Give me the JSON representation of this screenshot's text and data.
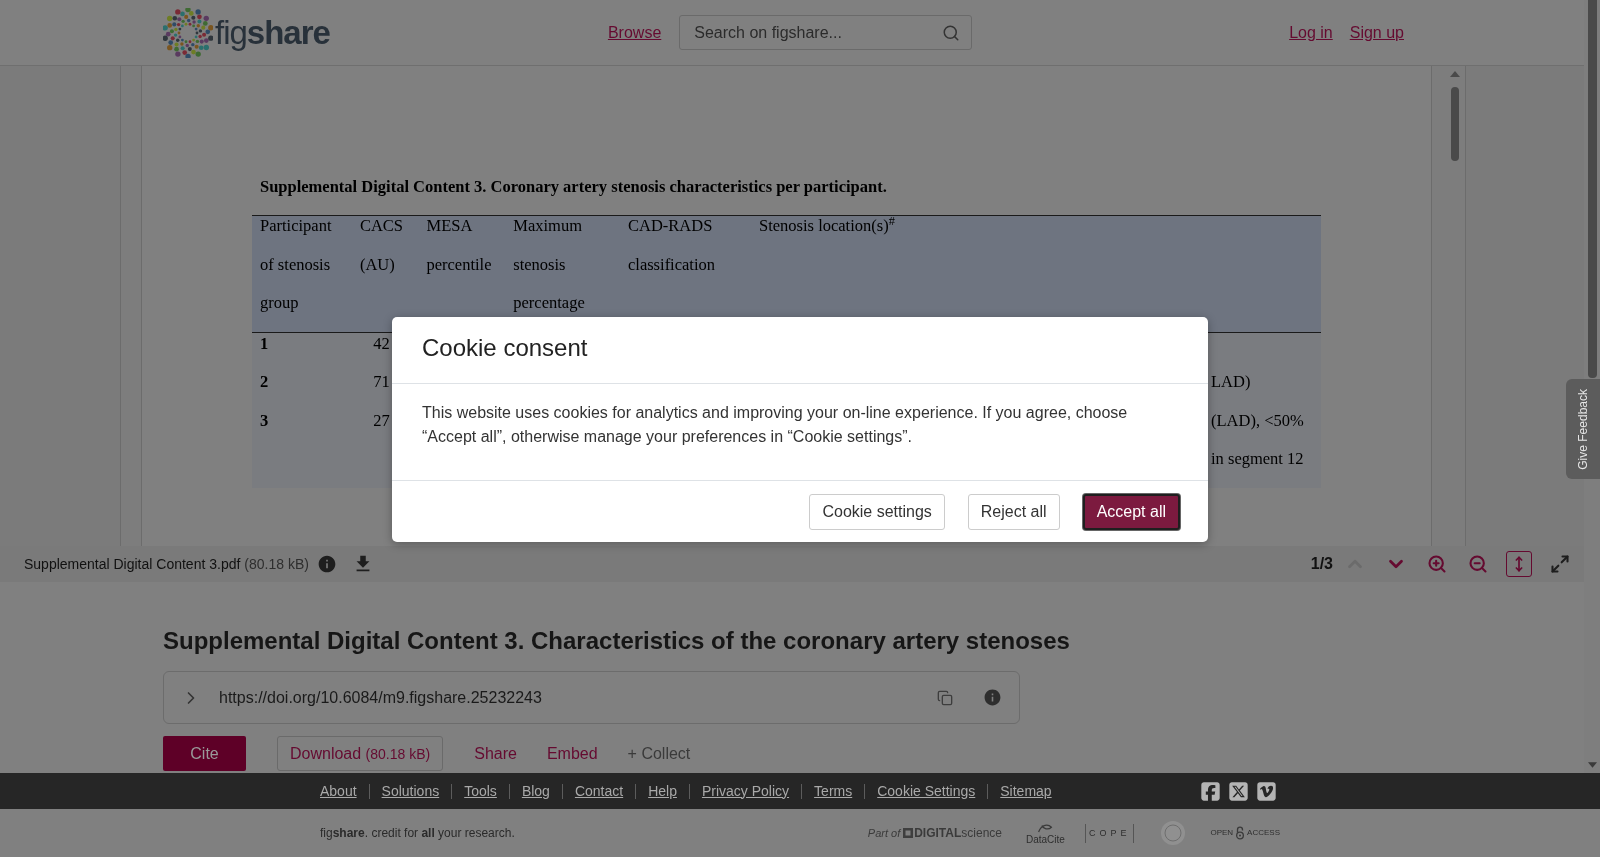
{
  "header": {
    "logo": "fig**share**",
    "nav_link": "Browse",
    "search": {
      "placeholder": "Search on figshare..."
    },
    "auth_links": [
      "Log in",
      "Sign up"
    ]
  },
  "pdf_viewer": {
    "heading": "Supplemental Digital Content 3. Coronary artery stenosis characteristics per participant.",
    "table": {
      "columns": [
        {
          "lines": [
            "Participant",
            "of stenosis",
            "group"
          ]
        },
        {
          "lines": [
            "CACS",
            "(AU)"
          ]
        },
        {
          "lines": [
            "MESA",
            "percentile"
          ]
        },
        {
          "lines": [
            "Maximum",
            "stenosis",
            "percentage"
          ]
        },
        {
          "lines": [
            "CAD-RADS",
            "classification"
          ]
        },
        {
          "lines": [
            "Stenosis location(s)$^{#}$"
          ]
        }
      ],
      "rows": [
        {
          "cells": [
            "1",
            "42"
          ]
        },
        {
          "cells": [
            "2",
            "71"
          ],
          "column_6": [
            "LAD)"
          ]
        },
        {
          "cells": [
            "3",
            "27"
          ],
          "column_6": [
            "(LAD), <50%",
            "in segment 12"
          ]
        }
      ]
    }
  },
  "toolbar": {
    "file_name": "Supplemental Digital Content 3.pdf",
    "file_size": "(80.18 kB)",
    "page": "1/3",
    "previous_disabled": true,
    "next_disabled": false,
    "view_controls": [
      {
        "kind": "zoom-in",
        "on": false
      },
      {
        "kind": "zoom-out",
        "on": false
      },
      {
        "kind": "fit-height",
        "on": true
      },
      {
        "kind": "fullscreen",
        "on": false
      }
    ]
  },
  "item": {
    "title": "Supplemental Digital Content 3. Characteristics of the coronary artery stenoses",
    "doi": "https://doi.org/10.6084/m9.figshare.25232243",
    "actions": [
      {
        "kind": "primary",
        "label": "Cite"
      },
      {
        "kind": "outline",
        "label": "Download",
        "size": "(80.18 kB)"
      },
      {
        "kind": "link",
        "label": "Share"
      },
      {
        "kind": "link",
        "label": "Embed"
      },
      {
        "kind": "muted",
        "label": "+ Collect"
      }
    ]
  },
  "footer": {
    "links": [
      "About",
      "Solutions",
      "Tools",
      "Blog",
      "Contact",
      "Help",
      "Privacy Policy",
      "Terms",
      "Cookie Settings",
      "Sitemap"
    ],
    "tagline": "fig**share**. credit for **all** your research.",
    "partners": {
      "digital_science_prefix": "Part of",
      "digital_science": "**DIGITAL**science",
      "datacite": "DataCite",
      "cope": "COPE",
      "open_access": [
        "OPEN",
        "ACCESS"
      ]
    }
  },
  "feedback_tab": {
    "label": "Give Feedback"
  },
  "cookie_dialog": {
    "title": "Cookie consent",
    "body": "This website uses cookies for analytics and improving your on-line experience. If you agree, choose “Accept all”, otherwise manage your preferences in “Cookie settings”.",
    "buttons": [
      {
        "kind": "secondary",
        "label": "Cookie settings",
        "focused": false
      },
      {
        "kind": "secondary",
        "label": "Reject all",
        "focused": false
      },
      {
        "kind": "primary",
        "label": "Accept all",
        "focused": true
      }
    ]
  }
}
